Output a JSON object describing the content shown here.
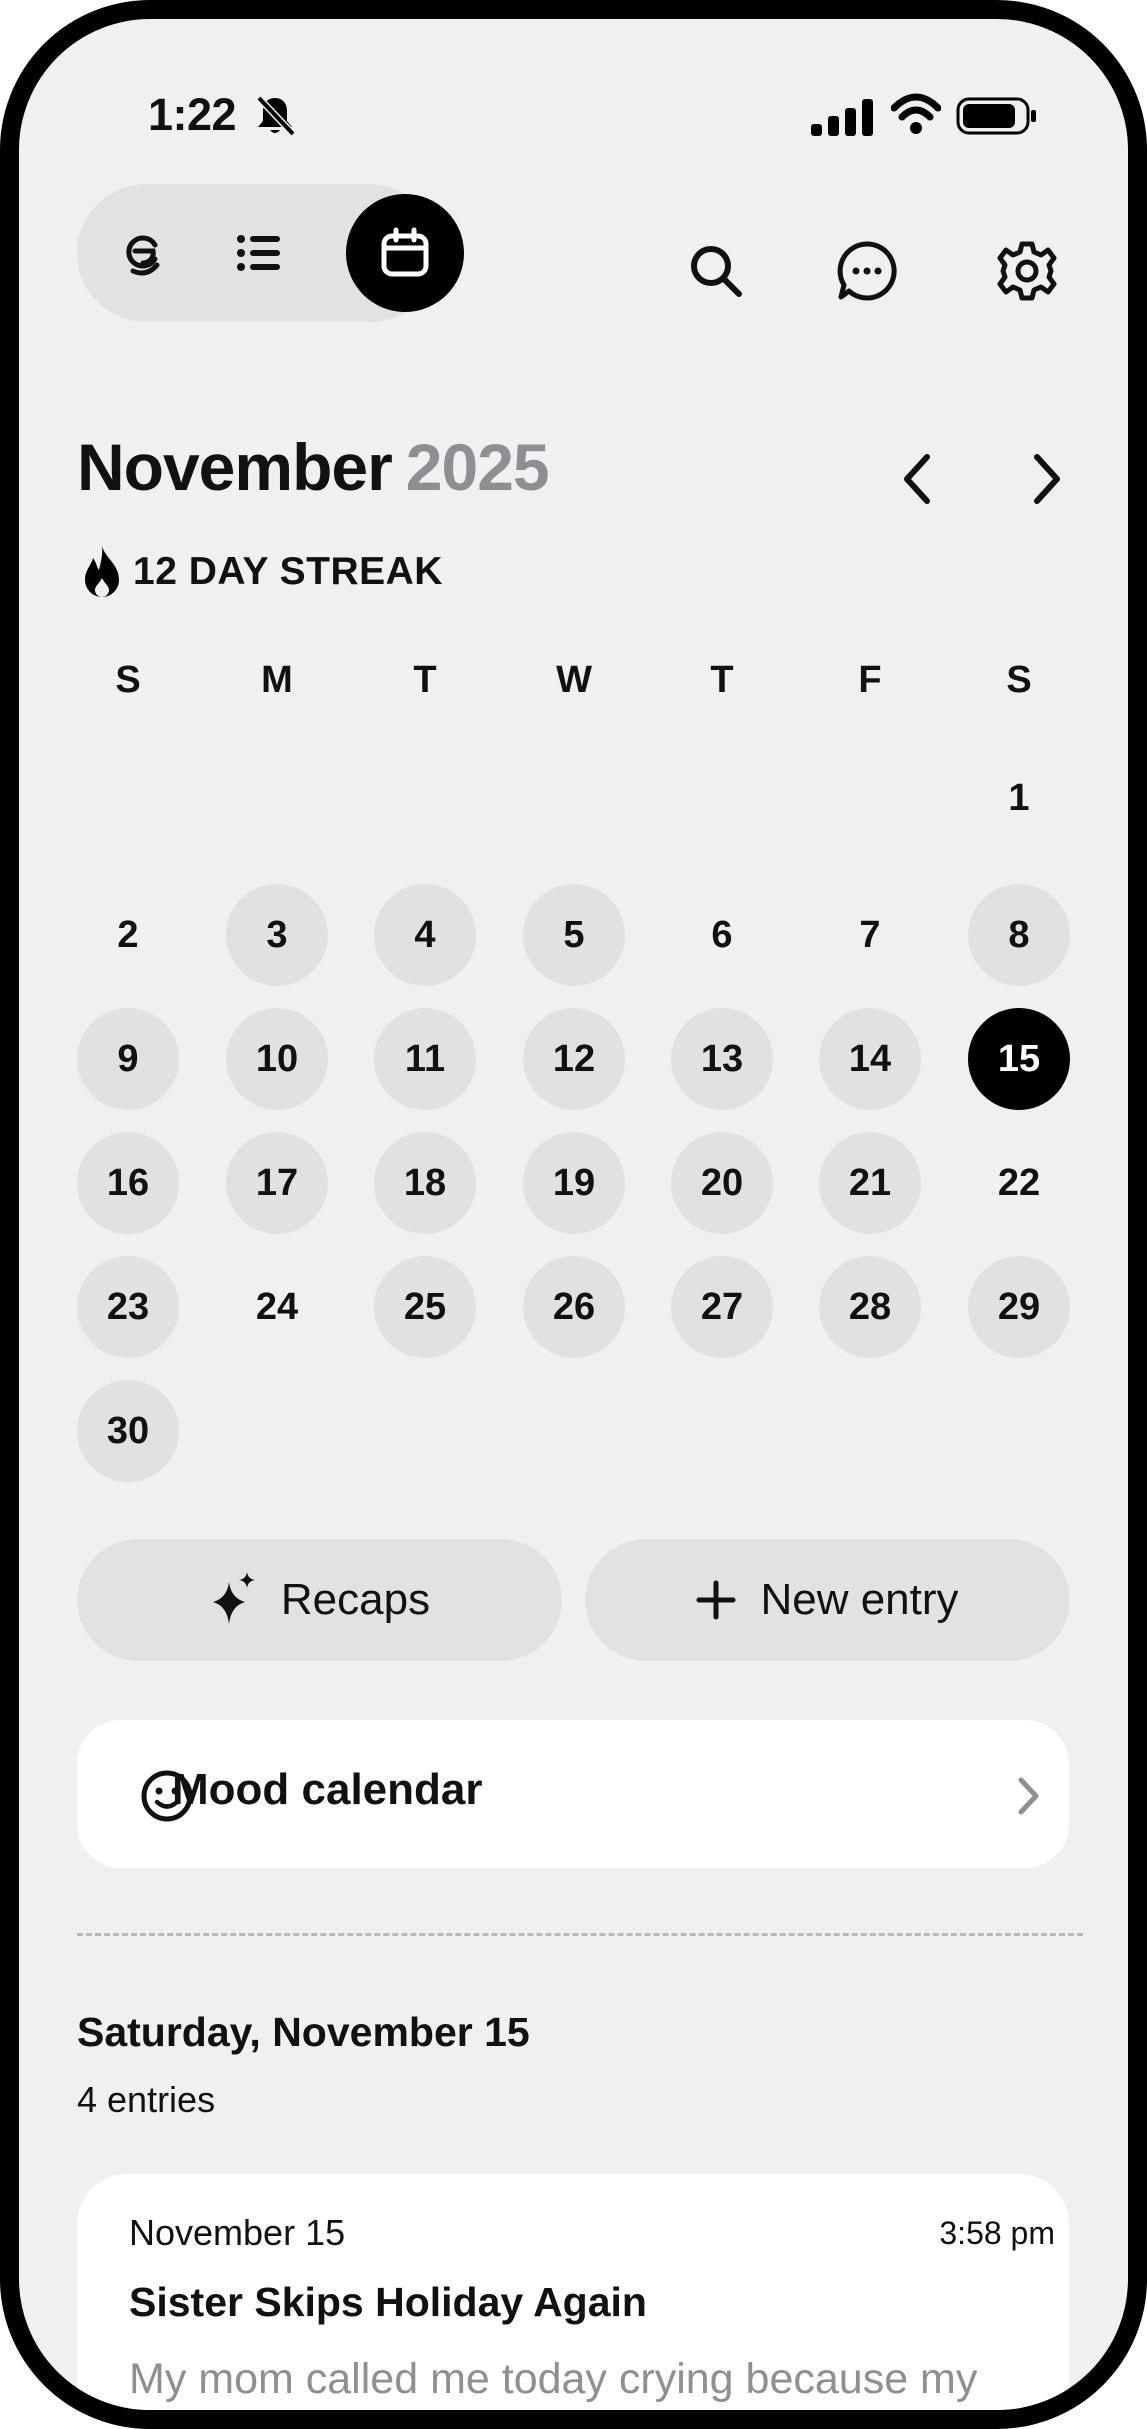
{
  "status_bar": {
    "time": "1:22"
  },
  "header": {
    "month": "November",
    "year": "2025",
    "streak": "12 DAY STREAK"
  },
  "calendar": {
    "weekdays": [
      "S",
      "M",
      "T",
      "W",
      "T",
      "F",
      "S"
    ],
    "days": [
      "1",
      "2",
      "3",
      "4",
      "5",
      "6",
      "7",
      "8",
      "9",
      "10",
      "11",
      "12",
      "13",
      "14",
      "15",
      "16",
      "17",
      "18",
      "19",
      "20",
      "21",
      "22",
      "23",
      "24",
      "25",
      "26",
      "27",
      "28",
      "29",
      "30"
    ],
    "entry_days": [
      "3",
      "4",
      "5",
      "8",
      "9",
      "10",
      "11",
      "12",
      "13",
      "14",
      "16",
      "17",
      "18",
      "19",
      "20",
      "21",
      "23",
      "25",
      "26",
      "27",
      "28",
      "29",
      "30"
    ],
    "selected_day": "15"
  },
  "actions": {
    "recaps_label": "Recaps",
    "new_entry_label": "New entry",
    "mood_label": "Mood calendar"
  },
  "section": {
    "title": "Saturday, November 15",
    "count": "4 entries"
  },
  "entry": {
    "date": "November 15",
    "time": "3:58 pm",
    "title": "Sister Skips Holiday Again",
    "body": "My mom called me today crying because my sister told her she's not coming home for T..."
  },
  "colors": {
    "background": "#f0f0f2",
    "entry_day": "#e1e1e3",
    "selected": "#000000",
    "muted": "#8e8e93"
  }
}
